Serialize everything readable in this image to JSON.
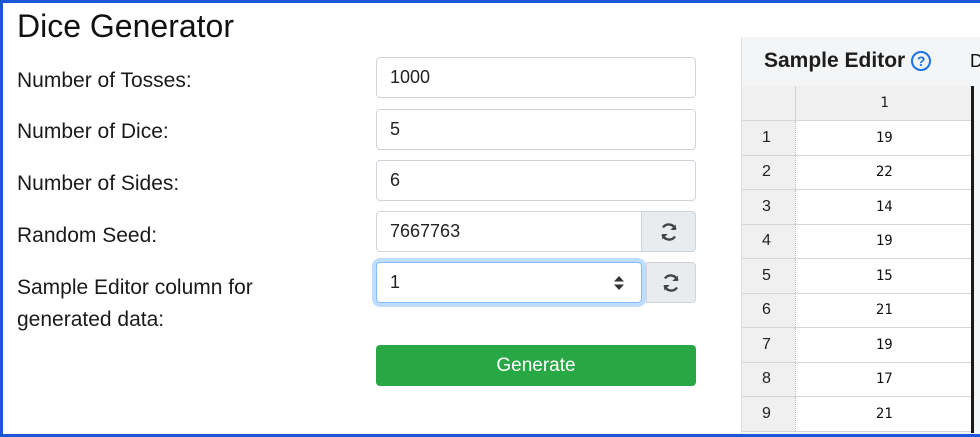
{
  "app": {
    "title": "Dice Generator"
  },
  "form": {
    "tosses": {
      "label": "Number of Tosses:",
      "value": "1000"
    },
    "dice": {
      "label": "Number of Dice:",
      "value": "5"
    },
    "sides": {
      "label": "Number of Sides:",
      "value": "6"
    },
    "seed": {
      "label": "Random Seed:",
      "value": "7667763"
    },
    "column": {
      "label_line1": "Sample Editor column for",
      "label_line2": "generated data:",
      "value": "1"
    },
    "generate_label": "Generate"
  },
  "editor": {
    "title": "Sample Editor",
    "help_glyph": "?",
    "clipped_char": "D",
    "column_header": "1",
    "rows": [
      {
        "row": "1",
        "value": "19"
      },
      {
        "row": "2",
        "value": "22"
      },
      {
        "row": "3",
        "value": "14"
      },
      {
        "row": "4",
        "value": "19"
      },
      {
        "row": "5",
        "value": "15"
      },
      {
        "row": "6",
        "value": "21"
      },
      {
        "row": "7",
        "value": "19"
      },
      {
        "row": "8",
        "value": "17"
      },
      {
        "row": "9",
        "value": "21"
      }
    ]
  },
  "colors": {
    "accent": "#28a745",
    "focus": "#80bdff",
    "frame": "#1a56d6",
    "help": "#1a73e8"
  },
  "icons": {
    "refresh": "refresh-icon",
    "select_caret": "chevron-up-down-icon",
    "help": "help-circle-icon"
  }
}
